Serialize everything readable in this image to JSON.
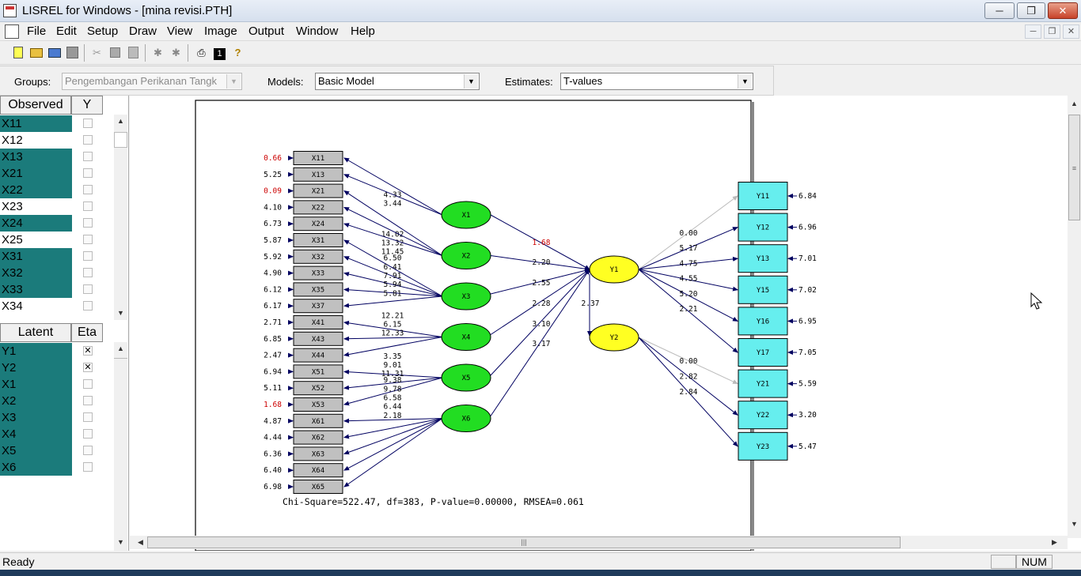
{
  "window": {
    "title": "LISREL for Windows - [mina revisi.PTH]"
  },
  "menu": [
    "File",
    "Edit",
    "Setup",
    "Draw",
    "View",
    "Image",
    "Output",
    "Window",
    "Help"
  ],
  "options": {
    "groups_label": "Groups:",
    "groups_value": "Pengembangan Perikanan Tangk",
    "models_label": "Models:",
    "models_value": "Basic Model",
    "estimates_label": "Estimates:",
    "estimates_value": "T-values"
  },
  "observed": {
    "header_name": "Observed",
    "header_flag": "Y",
    "rows": [
      {
        "name": "X11",
        "hl": true
      },
      {
        "name": "X12",
        "hl": false
      },
      {
        "name": "X13",
        "hl": true
      },
      {
        "name": "X21",
        "hl": true
      },
      {
        "name": "X22",
        "hl": true
      },
      {
        "name": "X23",
        "hl": false
      },
      {
        "name": "X24",
        "hl": true
      },
      {
        "name": "X25",
        "hl": false
      },
      {
        "name": "X31",
        "hl": true
      },
      {
        "name": "X32",
        "hl": true
      },
      {
        "name": "X33",
        "hl": true
      },
      {
        "name": "X34",
        "hl": false
      }
    ]
  },
  "latent": {
    "header_name": "Latent",
    "header_flag": "Eta",
    "rows": [
      {
        "name": "Y1",
        "checked": true
      },
      {
        "name": "Y2",
        "checked": true
      },
      {
        "name": "X1",
        "checked": false
      },
      {
        "name": "X2",
        "checked": false
      },
      {
        "name": "X3",
        "checked": false
      },
      {
        "name": "X4",
        "checked": false
      },
      {
        "name": "X5",
        "checked": false
      },
      {
        "name": "X6",
        "checked": false
      }
    ]
  },
  "diagram": {
    "x_indicators": [
      {
        "name": "X11",
        "err": "0.66",
        "red": true
      },
      {
        "name": "X13",
        "err": "5.25",
        "red": false
      },
      {
        "name": "X21",
        "err": "0.09",
        "red": true
      },
      {
        "name": "X22",
        "err": "4.10",
        "red": false
      },
      {
        "name": "X24",
        "err": "6.73",
        "red": false
      },
      {
        "name": "X31",
        "err": "5.87",
        "red": false
      },
      {
        "name": "X32",
        "err": "5.92",
        "red": false
      },
      {
        "name": "X33",
        "err": "4.90",
        "red": false
      },
      {
        "name": "X35",
        "err": "6.12",
        "red": false
      },
      {
        "name": "X37",
        "err": "6.17",
        "red": false
      },
      {
        "name": "X41",
        "err": "2.71",
        "red": false
      },
      {
        "name": "X43",
        "err": "6.85",
        "red": false
      },
      {
        "name": "X44",
        "err": "2.47",
        "red": false
      },
      {
        "name": "X51",
        "err": "6.94",
        "red": false
      },
      {
        "name": "X52",
        "err": "5.11",
        "red": false
      },
      {
        "name": "X53",
        "err": "1.68",
        "red": true
      },
      {
        "name": "X61",
        "err": "4.87",
        "red": false
      },
      {
        "name": "X62",
        "err": "4.44",
        "red": false
      },
      {
        "name": "X63",
        "err": "6.36",
        "red": false
      },
      {
        "name": "X64",
        "err": "6.40",
        "red": false
      },
      {
        "name": "X65",
        "err": "6.98",
        "red": false
      }
    ],
    "exogenous": [
      {
        "name": "X1",
        "loadings": [
          {
            "to": 0,
            "t": "4.33"
          },
          {
            "to": 1,
            "t": "3.44"
          }
        ]
      },
      {
        "name": "X2",
        "loadings": [
          {
            "to": 2,
            "t": "14.02"
          },
          {
            "to": 3,
            "t": "13.32"
          },
          {
            "to": 4,
            "t": "11.45"
          }
        ]
      },
      {
        "name": "X3",
        "loadings": [
          {
            "to": 5,
            "t": "6.50"
          },
          {
            "to": 6,
            "t": "6.41"
          },
          {
            "to": 7,
            "t": "7.91"
          },
          {
            "to": 8,
            "t": "5.94"
          },
          {
            "to": 9,
            "t": "5.81"
          }
        ]
      },
      {
        "name": "X4",
        "loadings": [
          {
            "to": 10,
            "t": "12.21"
          },
          {
            "to": 11,
            "t": "6.15"
          },
          {
            "to": 12,
            "t": "12.33"
          }
        ]
      },
      {
        "name": "X5",
        "loadings": [
          {
            "to": 13,
            "t": "3.35"
          },
          {
            "to": 14,
            "t": "9.01"
          },
          {
            "to": 15,
            "t": "11.31"
          }
        ]
      },
      {
        "name": "X6",
        "loadings": [
          {
            "to": 16,
            "t": "9.38"
          },
          {
            "to": 17,
            "t": "9.78"
          },
          {
            "to": 18,
            "t": "6.58"
          },
          {
            "to": 19,
            "t": "6.44"
          },
          {
            "to": 20,
            "t": "2.18"
          }
        ]
      }
    ],
    "gamma": [
      {
        "from": "X1",
        "t": "1.68",
        "red": true
      },
      {
        "from": "X2",
        "t": "2.20",
        "red": false
      },
      {
        "from": "X3",
        "t": "2.55",
        "red": false
      },
      {
        "from": "X4",
        "t": "2.28",
        "red": false
      },
      {
        "from": "X5",
        "t": "3.10",
        "red": false
      },
      {
        "from": "X6",
        "t": "3.17",
        "red": false
      }
    ],
    "beta": {
      "label": "2.37"
    },
    "endogenous": [
      "Y1",
      "Y2"
    ],
    "y_indicators": [
      {
        "name": "Y11",
        "err": "6.84",
        "from": "Y1",
        "t": "0.00",
        "fixed": true
      },
      {
        "name": "Y12",
        "err": "6.96",
        "from": "Y1",
        "t": "5.17",
        "fixed": false
      },
      {
        "name": "Y13",
        "err": "7.01",
        "from": "Y1",
        "t": "4.75",
        "fixed": false
      },
      {
        "name": "Y15",
        "err": "7.02",
        "from": "Y1",
        "t": "4.55",
        "fixed": false
      },
      {
        "name": "Y16",
        "err": "6.95",
        "from": "Y1",
        "t": "5.20",
        "fixed": false
      },
      {
        "name": "Y17",
        "err": "7.05",
        "from": "Y1",
        "t": "2.21",
        "fixed": false
      },
      {
        "name": "Y21",
        "err": "5.59",
        "from": "Y2",
        "t": "0.00",
        "fixed": true
      },
      {
        "name": "Y22",
        "err": "3.20",
        "from": "Y2",
        "t": "2.82",
        "fixed": false
      },
      {
        "name": "Y23",
        "err": "5.47",
        "from": "Y2",
        "t": "2.84",
        "fixed": false
      }
    ],
    "fit": "Chi-Square=522.47, df=383, P-value=0.00000, RMSEA=0.061",
    "colors": {
      "exo": "#22dd22",
      "endo": "#ffff22",
      "xbox": "#c0c0c0",
      "ybox": "#66eeee",
      "arrow": "#000060",
      "fixed": "#bbbbbb",
      "red": "#cc0000"
    }
  },
  "status": {
    "text": "Ready",
    "num": "NUM"
  }
}
